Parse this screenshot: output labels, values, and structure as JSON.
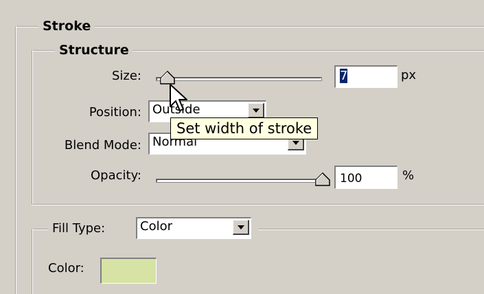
{
  "stroke": {
    "title": "Stroke",
    "structure": {
      "title": "Structure",
      "size": {
        "label": "Size:",
        "value": "7",
        "unit": "px",
        "slider_fraction": 0.03
      },
      "position": {
        "label": "Position:",
        "value": "Outside"
      },
      "blend_mode": {
        "label": "Blend Mode:",
        "value": "Normal"
      },
      "opacity": {
        "label": "Opacity:",
        "value": "100",
        "unit": "%",
        "slider_fraction": 1.0
      }
    },
    "fill": {
      "type_label": "Fill Type:",
      "type_value": "Color",
      "color_label": "Color:",
      "color_value": "#d6e3a4"
    },
    "tooltip": "Set width of stroke"
  },
  "colors": {
    "background": "#d4d0c8",
    "tooltip_bg": "#ffffe1",
    "selection": "#0a246a"
  },
  "icons": [
    "slider-thumb-icon",
    "dropdown-arrow-icon",
    "mouse-cursor-icon"
  ]
}
